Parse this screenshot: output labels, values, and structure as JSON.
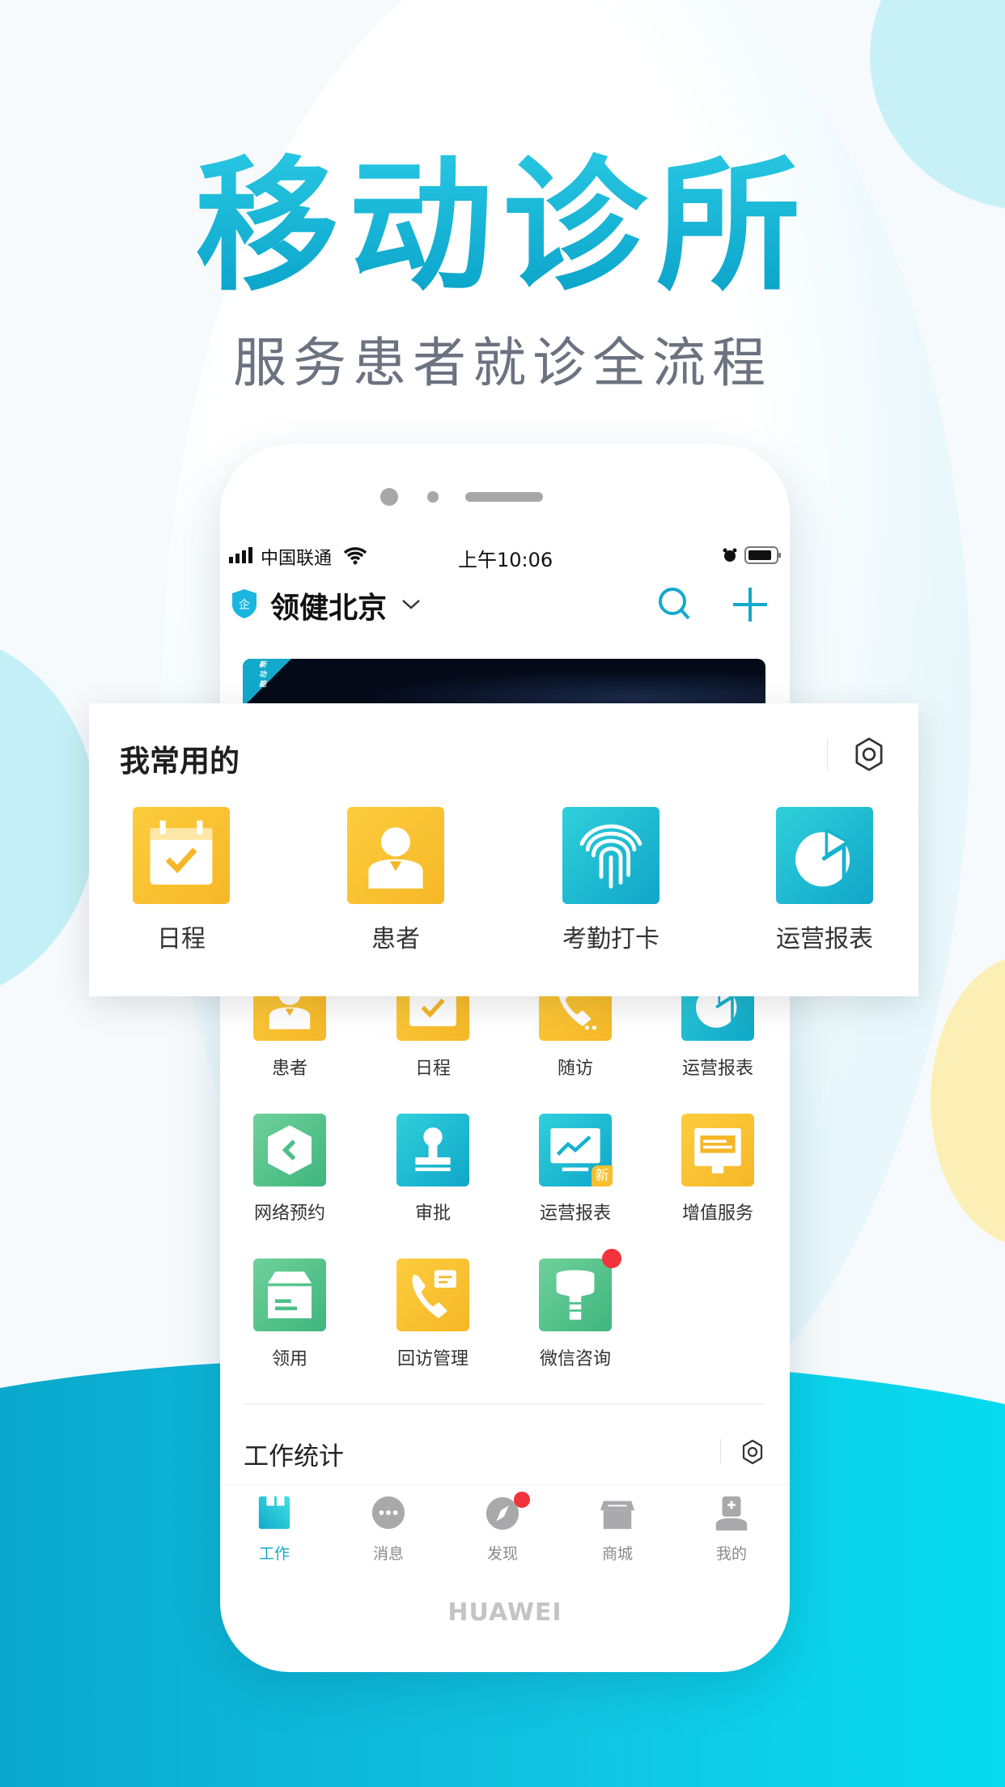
{
  "hero": {
    "title": "移动诊所",
    "subtitle": "服务患者就诊全流程"
  },
  "status_bar": {
    "carrier": "中国联通",
    "time": "上午10:06"
  },
  "header": {
    "org_name": "领健北京",
    "org_badge": "企"
  },
  "banner": {
    "tag": "新功能"
  },
  "favorites": {
    "title": "我常用的",
    "items": [
      {
        "label": "日程",
        "icon": "calendar-check-icon",
        "color": "#f8bf2e"
      },
      {
        "label": "患者",
        "icon": "patient-icon",
        "color": "#f8bf2e"
      },
      {
        "label": "考勤打卡",
        "icon": "fingerprint-icon",
        "color": "#17b2cf"
      },
      {
        "label": "运营报表",
        "icon": "pie-chart-icon",
        "color": "#17b2cf"
      }
    ]
  },
  "grid": [
    {
      "label": "患者",
      "icon": "patient-icon"
    },
    {
      "label": "日程",
      "icon": "calendar-check-icon"
    },
    {
      "label": "随访",
      "icon": "phone-icon"
    },
    {
      "label": "运营报表",
      "icon": "pie-chart-icon"
    },
    {
      "label": "网络预约",
      "icon": "hexagon-icon"
    },
    {
      "label": "审批",
      "icon": "stamp-icon"
    },
    {
      "label": "运营报表",
      "icon": "monitor-chart-icon",
      "badge": "新"
    },
    {
      "label": "增值服务",
      "icon": "screen-icon"
    },
    {
      "label": "领用",
      "icon": "box-icon"
    },
    {
      "label": "回访管理",
      "icon": "phone-message-icon"
    },
    {
      "label": "微信咨询",
      "icon": "tooth-icon",
      "dot": true
    }
  ],
  "stats": {
    "title": "工作统计"
  },
  "tabs": [
    {
      "label": "工作",
      "active": true
    },
    {
      "label": "消息"
    },
    {
      "label": "发现",
      "dot": true
    },
    {
      "label": "商城"
    },
    {
      "label": "我的"
    }
  ],
  "brand": "HUAWEI",
  "colors": {
    "accent": "#12a9cc",
    "yellow": "#f8bf2e",
    "green": "#4cbf87",
    "red": "#f2333b"
  }
}
